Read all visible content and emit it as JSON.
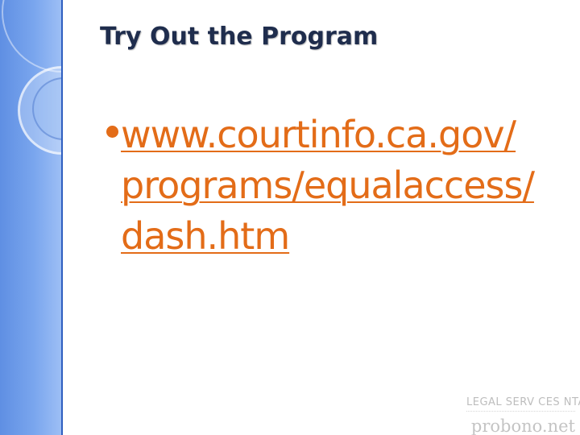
{
  "slide": {
    "title": "Try Out the Program",
    "bullet": {
      "link_lines": [
        "www.courtinfo.ca.gov/",
        "programs/equalaccess/",
        "dash.htm"
      ]
    },
    "logo": {
      "top_text": "LEGAL SERV CES NTAP",
      "bottom_text": "probono.net"
    }
  },
  "colors": {
    "title": "#1f2d4d",
    "link": "#e36c18",
    "sidebar": "#7aa6ee",
    "logo": "#c4c4c4"
  }
}
